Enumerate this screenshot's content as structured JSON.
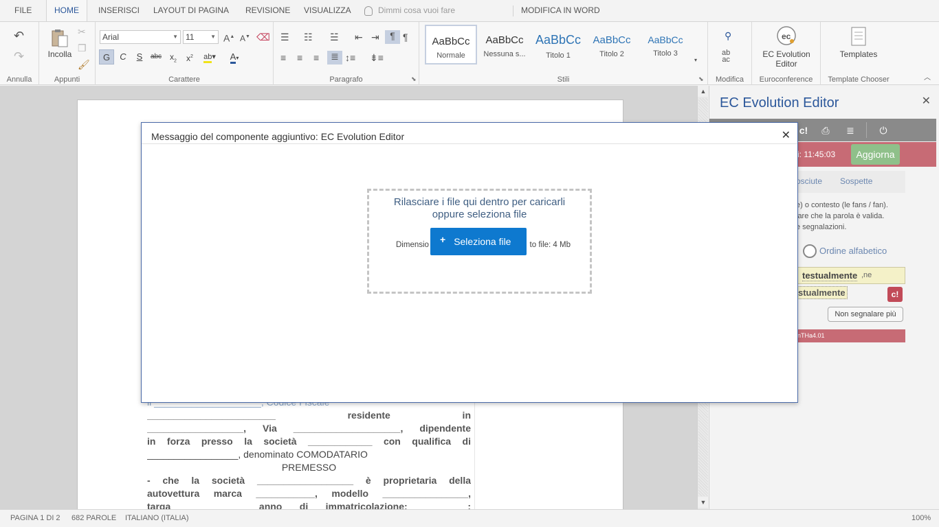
{
  "tabs": [
    {
      "label": "FILE",
      "active": false
    },
    {
      "label": "HOME",
      "active": true
    },
    {
      "label": "INSERISCI",
      "active": false
    },
    {
      "label": "LAYOUT DI PAGINA",
      "active": false
    },
    {
      "label": "REVISIONE",
      "active": false
    },
    {
      "label": "VISUALIZZA",
      "active": false
    }
  ],
  "tell_me": "Dimmi cosa vuoi fare",
  "edit_in_word": "MODIFICA IN WORD",
  "ribbon": {
    "groups": {
      "undo": "Annulla",
      "clipboard": "Appunti",
      "font": "Carattere",
      "paragraph": "Paragrafo",
      "styles": "Stili",
      "edit": "Modifica",
      "euroconference": "Euroconference",
      "template_chooser": "Template Chooser"
    },
    "paste_label": "Incolla",
    "font_name": "Arial",
    "font_size": "11",
    "format_buttons": {
      "bold": "G",
      "italic": "C",
      "underline": "S",
      "strike": "abc"
    },
    "styles": [
      {
        "sample": "AaBbCc",
        "name": "Normale",
        "color": "#333333"
      },
      {
        "sample": "AaBbCc",
        "name": "Nessuna s...",
        "color": "#333333"
      },
      {
        "sample": "AaBbCc",
        "name": "Titolo 1",
        "color": "#2e74b5"
      },
      {
        "sample": "AaBbCc",
        "name": "Titolo 2",
        "color": "#2e74b5"
      },
      {
        "sample": "AaBbCc",
        "name": "Titolo 3",
        "color": "#2e74b5"
      }
    ],
    "ec_editor_label": "EC Evolution Editor",
    "templates_label": "Templates"
  },
  "document": {
    "lines": [
      "il ____________________, Codice Fiscale",
      "________________________ residente in",
      "__________________, Via ____________________, dipendente",
      "in forza presso la società ____________ con qualifica di",
      "_________________, denominato COMODATARIO",
      "PREMESSO",
      "- che la società __________________ è proprietaria della",
      "autovettura marca ___________, modello ________________,",
      "targa __________ anno di immatricolazione: ________;"
    ]
  },
  "pane": {
    "title": "EC Evolution Editor",
    "time": "i: 11:45:03",
    "update_button": "Aggiorna",
    "tabs": [
      "osciute",
      "Sospette"
    ],
    "description_lines": [
      "e) o contesto (le fans / fan).",
      "lare che la parola è valida.",
      "e segnalazioni."
    ],
    "sort_label": "Ordine alfabetico",
    "word": "testualmente",
    "word_suffix": ",ne",
    "word_partial": "stualmente",
    "flag_label": "c!",
    "no_report_button": "Non segnalare più",
    "version_text": "nTHa4.01"
  },
  "status": {
    "page": "PAGINA 1 DI 2",
    "words": "682 PAROLE",
    "language": "ITALIANO (ITALIA)",
    "zoom": "100%"
  },
  "modal": {
    "title": "Messaggio del componente aggiuntivo: EC Evolution Editor",
    "drop_line1": "Rilasciare i file qui dentro per caricarli",
    "drop_line2": "oppure seleziona file",
    "size_left": "Dimensio",
    "size_right": "to file: 4 Mb",
    "select_button": "Seleziona file"
  }
}
